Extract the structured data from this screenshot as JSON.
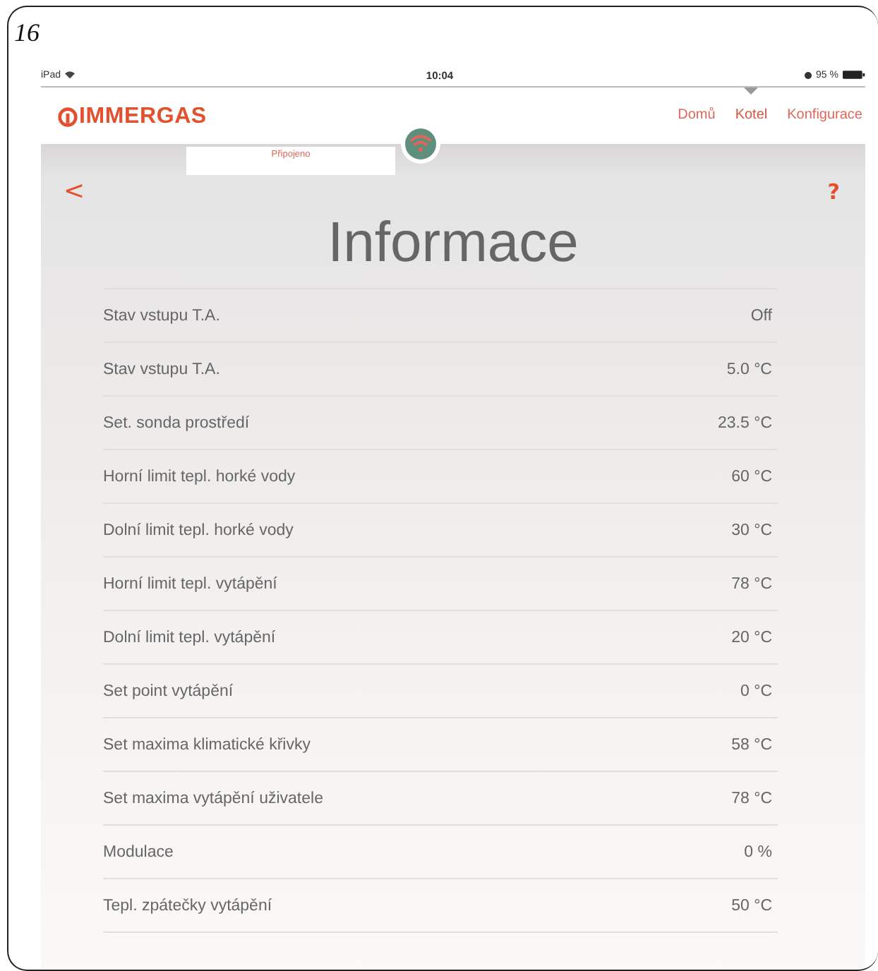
{
  "page_number": "16",
  "status_bar": {
    "device": "iPad",
    "time": "10:04",
    "battery": "95 %"
  },
  "header": {
    "logo": "IMMERGAS",
    "nav": [
      {
        "label": "Domů",
        "selected": false
      },
      {
        "label": "Kotel",
        "selected": true
      },
      {
        "label": "Konfigurace",
        "selected": false
      }
    ]
  },
  "connection": {
    "label": "Připojeno"
  },
  "toolbar": {
    "back": "<",
    "help": "?"
  },
  "title": "Informace",
  "rows": [
    {
      "label": "Stav vstupu T.A.",
      "value": "Off"
    },
    {
      "label": "Stav vstupu T.A.",
      "value": "5.0 °C"
    },
    {
      "label": "Set. sonda prostředí",
      "value": "23.5 °C"
    },
    {
      "label": "Horní limit tepl. horké vody",
      "value": "60 °C"
    },
    {
      "label": "Dolní limit tepl. horké vody",
      "value": "30 °C"
    },
    {
      "label": "Horní limit tepl. vytápění",
      "value": "78 °C"
    },
    {
      "label": "Dolní limit tepl. vytápění",
      "value": "20 °C"
    },
    {
      "label": "Set point vytápění",
      "value": "0 °C"
    },
    {
      "label": "Set maxima klimatické křivky",
      "value": "58 °C"
    },
    {
      "label": "Set maxima vytápění uživatele",
      "value": "78 °C"
    },
    {
      "label": "Modulace",
      "value": "0 %"
    },
    {
      "label": "Tepl. zpátečky vytápění",
      "value": "50 °C"
    }
  ]
}
